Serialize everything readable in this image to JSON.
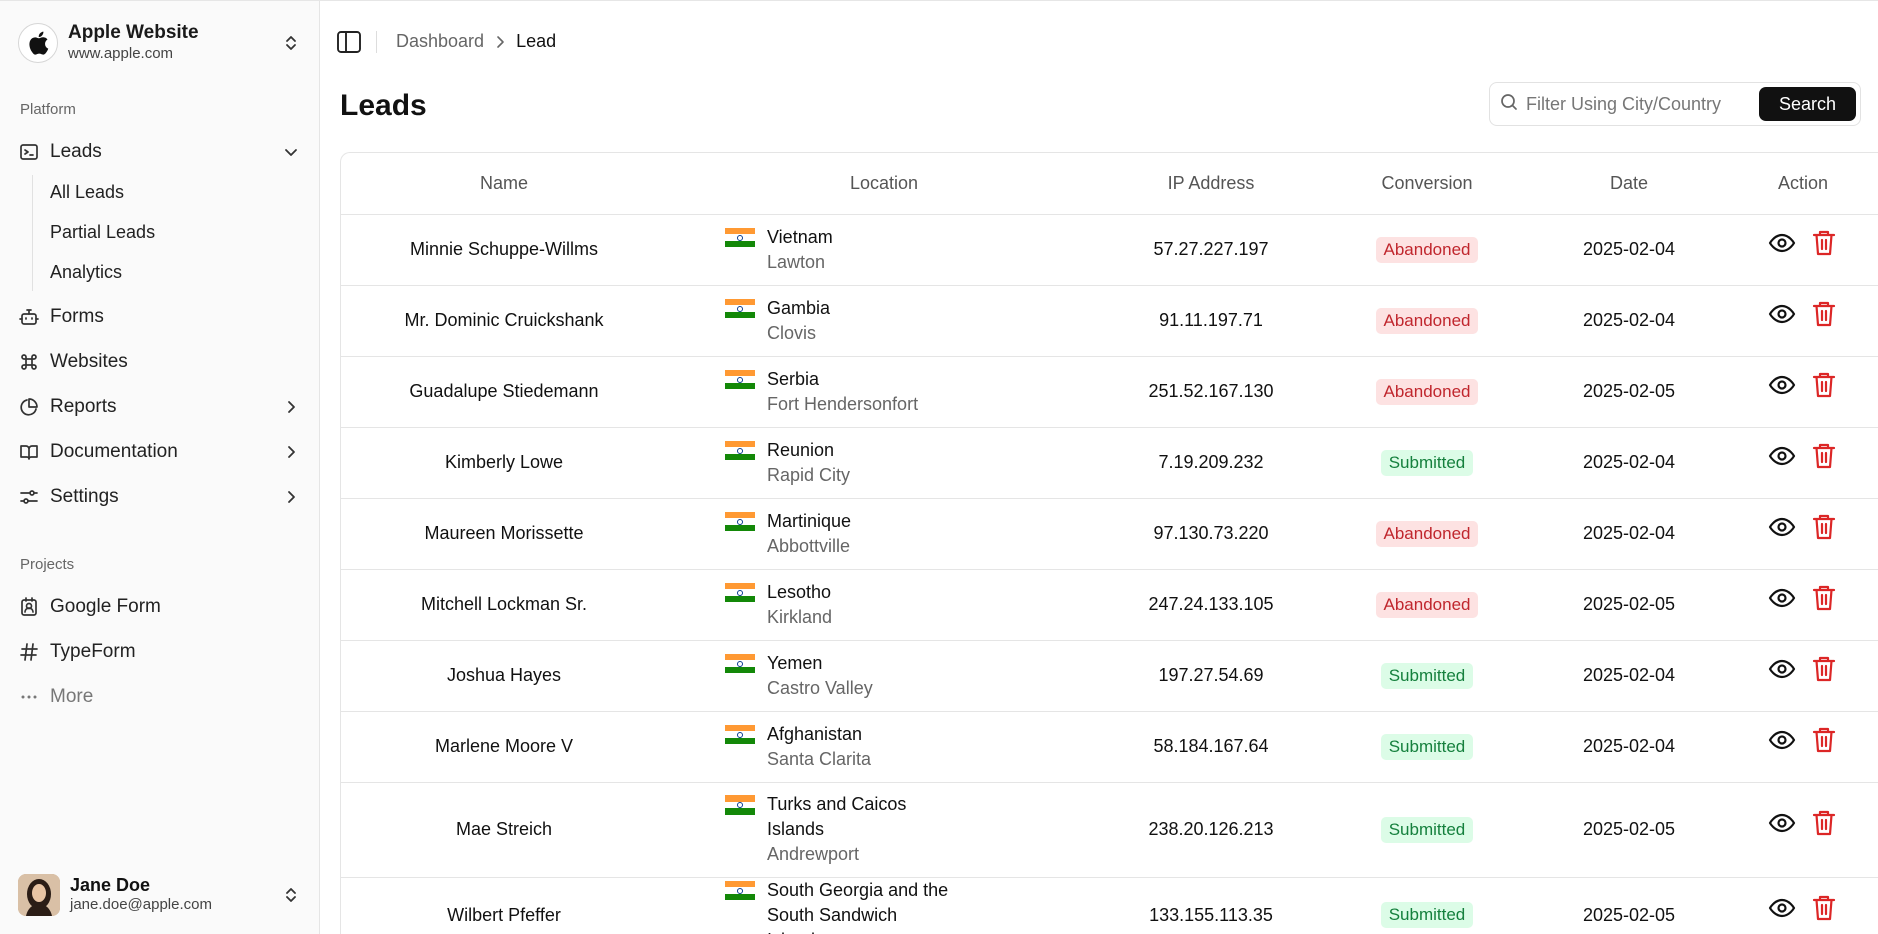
{
  "workspace": {
    "title": "Apple Website",
    "url": "www.apple.com"
  },
  "sidebar": {
    "platform_label": "Platform",
    "leads": {
      "label": "Leads",
      "sub": [
        "All Leads",
        "Partial Leads",
        "Analytics"
      ]
    },
    "forms": "Forms",
    "websites": "Websites",
    "reports": "Reports",
    "documentation": "Documentation",
    "settings": "Settings",
    "projects_label": "Projects",
    "projects": [
      "Google Form",
      "TypeForm"
    ],
    "more": "More"
  },
  "user": {
    "name": "Jane Doe",
    "email": "jane.doe@apple.com"
  },
  "breadcrumb": {
    "parent": "Dashboard",
    "current": "Lead"
  },
  "page": {
    "title": "Leads"
  },
  "search": {
    "placeholder": "Filter Using City/Country",
    "button": "Search"
  },
  "table": {
    "columns": [
      "Name",
      "Location",
      "IP Address",
      "Conversion",
      "Date",
      "Action"
    ],
    "rows": [
      {
        "name": "Minnie Schuppe-Willms",
        "country": "Vietnam",
        "city": "Lawton",
        "ip": "57.27.227.197",
        "conversion": "Abandoned",
        "date": "2025-02-04"
      },
      {
        "name": "Mr. Dominic Cruickshank",
        "country": "Gambia",
        "city": "Clovis",
        "ip": "91.11.197.71",
        "conversion": "Abandoned",
        "date": "2025-02-04"
      },
      {
        "name": "Guadalupe Stiedemann",
        "country": "Serbia",
        "city": "Fort Hendersonfort",
        "ip": "251.52.167.130",
        "conversion": "Abandoned",
        "date": "2025-02-05"
      },
      {
        "name": "Kimberly Lowe",
        "country": "Reunion",
        "city": "Rapid City",
        "ip": "7.19.209.232",
        "conversion": "Submitted",
        "date": "2025-02-04"
      },
      {
        "name": "Maureen Morissette",
        "country": "Martinique",
        "city": "Abbottville",
        "ip": "97.130.73.220",
        "conversion": "Abandoned",
        "date": "2025-02-04"
      },
      {
        "name": "Mitchell Lockman Sr.",
        "country": "Lesotho",
        "city": "Kirkland",
        "ip": "247.24.133.105",
        "conversion": "Abandoned",
        "date": "2025-02-05"
      },
      {
        "name": "Joshua Hayes",
        "country": "Yemen",
        "city": "Castro Valley",
        "ip": "197.27.54.69",
        "conversion": "Submitted",
        "date": "2025-02-04"
      },
      {
        "name": "Marlene Moore V",
        "country": "Afghanistan",
        "city": "Santa Clarita",
        "ip": "58.184.167.64",
        "conversion": "Submitted",
        "date": "2025-02-04"
      },
      {
        "name": "Mae Streich",
        "country": "Turks and Caicos Islands",
        "city": "Andrewport",
        "ip": "238.20.126.213",
        "conversion": "Submitted",
        "date": "2025-02-05"
      },
      {
        "name": "Wilbert Pfeffer",
        "country": "South Georgia and the South Sandwich Islands",
        "city": "",
        "ip": "133.155.113.35",
        "conversion": "Submitted",
        "date": "2025-02-05"
      }
    ]
  },
  "colors": {
    "abandoned_bg": "#fde2e2",
    "abandoned_fg": "#c0262d",
    "submitted_bg": "#dcfce7",
    "submitted_fg": "#15803d",
    "delete_icon": "#dc2626"
  }
}
